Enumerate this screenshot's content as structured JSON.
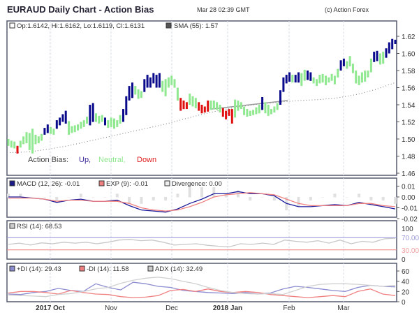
{
  "header": {
    "title": "EURAUD Daily Chart - Action Bias",
    "timestamp": "Mar 28 02:39 GMT",
    "copyright": "(c) Action Forex"
  },
  "colors": {
    "up": "#0a0a8c",
    "neutral": "#90e890",
    "down": "#e01010",
    "macd": "#1a1a9a",
    "exp": "#f08080",
    "divergence": "#e0e0e0",
    "rsi": "#c8c8c8",
    "plus_di": "#8c8cd0",
    "minus_di": "#f08080",
    "adx": "#d0d0d0"
  },
  "chart_data": [
    {
      "type": "ohlc-bars",
      "title": "EURAUD Daily Chart - Action Bias",
      "ohlc_label": "Op:1.6142, Hi:1.6162, Lo:1.6119, Cl:1.6131",
      "sma_label": "SMA (55): 1.57",
      "bias_legend": {
        "label": "Action Bias:",
        "up": "Up,",
        "neutral": "Neutral,",
        "down": "Down"
      },
      "ylim": [
        1.46,
        1.63
      ],
      "yticks": [
        "1.62",
        "1.60",
        "1.58",
        "1.56",
        "1.54",
        "1.52",
        "1.50",
        "1.48",
        "1.46"
      ],
      "xticks": [
        "2017 Oct",
        "Nov",
        "Dec",
        "2018 Jan",
        "Feb",
        "Mar"
      ],
      "bars": [
        [
          1.5,
          1.492,
          "n"
        ],
        [
          1.498,
          1.49,
          "n"
        ],
        [
          1.497,
          1.489,
          "n"
        ],
        [
          1.492,
          1.483,
          "d"
        ],
        [
          1.498,
          1.49,
          "n"
        ],
        [
          1.503,
          1.494,
          "n"
        ],
        [
          1.508,
          1.495,
          "n"
        ],
        [
          1.507,
          1.487,
          "n"
        ],
        [
          1.512,
          1.483,
          "n"
        ],
        [
          1.505,
          1.494,
          "n"
        ],
        [
          1.503,
          1.495,
          "n"
        ],
        [
          1.506,
          1.498,
          "n"
        ],
        [
          1.513,
          1.505,
          "u"
        ],
        [
          1.517,
          1.507,
          "u"
        ],
        [
          1.514,
          1.506,
          "n"
        ],
        [
          1.512,
          1.505,
          "n"
        ],
        [
          1.522,
          1.512,
          "u"
        ],
        [
          1.525,
          1.516,
          "u"
        ],
        [
          1.529,
          1.52,
          "u"
        ],
        [
          1.533,
          1.518,
          "u"
        ],
        [
          1.521,
          1.505,
          "n"
        ],
        [
          1.515,
          1.507,
          "n"
        ],
        [
          1.516,
          1.508,
          "n"
        ],
        [
          1.517,
          1.51,
          "n"
        ],
        [
          1.52,
          1.512,
          "n"
        ],
        [
          1.522,
          1.514,
          "n"
        ],
        [
          1.526,
          1.518,
          "n"
        ],
        [
          1.54,
          1.516,
          "u"
        ],
        [
          1.542,
          1.52,
          "u"
        ],
        [
          1.53,
          1.52,
          "n"
        ],
        [
          1.527,
          1.518,
          "n"
        ],
        [
          1.528,
          1.52,
          "n"
        ],
        [
          1.525,
          1.516,
          "u"
        ],
        [
          1.522,
          1.513,
          "n"
        ],
        [
          1.525,
          1.514,
          "n"
        ],
        [
          1.524,
          1.512,
          "n"
        ],
        [
          1.522,
          1.514,
          "n"
        ],
        [
          1.528,
          1.518,
          "n"
        ],
        [
          1.535,
          1.52,
          "u"
        ],
        [
          1.55,
          1.528,
          "u"
        ],
        [
          1.562,
          1.545,
          "u"
        ],
        [
          1.566,
          1.548,
          "u"
        ],
        [
          1.562,
          1.552,
          "n"
        ],
        [
          1.558,
          1.547,
          "n"
        ],
        [
          1.556,
          1.548,
          "n"
        ],
        [
          1.57,
          1.555,
          "u"
        ],
        [
          1.575,
          1.56,
          "u"
        ],
        [
          1.572,
          1.56,
          "u"
        ],
        [
          1.577,
          1.565,
          "u"
        ],
        [
          1.575,
          1.56,
          "u"
        ],
        [
          1.577,
          1.56,
          "u"
        ],
        [
          1.568,
          1.555,
          "n"
        ],
        [
          1.57,
          1.55,
          "n"
        ],
        [
          1.572,
          1.56,
          "n"
        ],
        [
          1.574,
          1.563,
          "n"
        ],
        [
          1.57,
          1.56,
          "n"
        ],
        [
          1.56,
          1.545,
          "n"
        ],
        [
          1.548,
          1.533,
          "d"
        ],
        [
          1.545,
          1.535,
          "d"
        ],
        [
          1.543,
          1.535,
          "d"
        ],
        [
          1.553,
          1.54,
          "n"
        ],
        [
          1.55,
          1.538,
          "n"
        ],
        [
          1.548,
          1.536,
          "n"
        ],
        [
          1.543,
          1.533,
          "d"
        ],
        [
          1.54,
          1.53,
          "d"
        ],
        [
          1.538,
          1.531,
          "d"
        ],
        [
          1.545,
          1.532,
          "d"
        ],
        [
          1.545,
          1.534,
          "n"
        ],
        [
          1.545,
          1.535,
          "n"
        ],
        [
          1.543,
          1.534,
          "n"
        ],
        [
          1.54,
          1.531,
          "n"
        ],
        [
          1.536,
          1.526,
          "d"
        ],
        [
          1.533,
          1.523,
          "d"
        ],
        [
          1.535,
          1.527,
          "d"
        ],
        [
          1.535,
          1.518,
          "d"
        ],
        [
          1.546,
          1.525,
          "n"
        ],
        [
          1.545,
          1.533,
          "n"
        ],
        [
          1.543,
          1.535,
          "n"
        ],
        [
          1.538,
          1.528,
          "n"
        ],
        [
          1.535,
          1.526,
          "n"
        ],
        [
          1.533,
          1.527,
          "n"
        ],
        [
          1.534,
          1.528,
          "n"
        ],
        [
          1.537,
          1.529,
          "n"
        ],
        [
          1.54,
          1.53,
          "n"
        ],
        [
          1.549,
          1.534,
          "u"
        ],
        [
          1.543,
          1.53,
          "n"
        ],
        [
          1.54,
          1.527,
          "n"
        ],
        [
          1.535,
          1.529,
          "n"
        ],
        [
          1.538,
          1.531,
          "n"
        ],
        [
          1.542,
          1.534,
          "n"
        ],
        [
          1.557,
          1.54,
          "u"
        ],
        [
          1.572,
          1.555,
          "u"
        ],
        [
          1.575,
          1.565,
          "u"
        ],
        [
          1.578,
          1.567,
          "u"
        ],
        [
          1.575,
          1.566,
          "n"
        ],
        [
          1.575,
          1.566,
          "u"
        ],
        [
          1.578,
          1.566,
          "u"
        ],
        [
          1.577,
          1.562,
          "n"
        ],
        [
          1.581,
          1.568,
          "n"
        ],
        [
          1.58,
          1.569,
          "u"
        ],
        [
          1.578,
          1.568,
          "u"
        ],
        [
          1.572,
          1.565,
          "n"
        ],
        [
          1.57,
          1.562,
          "n"
        ],
        [
          1.575,
          1.565,
          "n"
        ],
        [
          1.576,
          1.566,
          "n"
        ],
        [
          1.574,
          1.563,
          "n"
        ],
        [
          1.572,
          1.566,
          "n"
        ],
        [
          1.576,
          1.568,
          "n"
        ],
        [
          1.574,
          1.564,
          "n"
        ],
        [
          1.582,
          1.572,
          "n"
        ],
        [
          1.592,
          1.58,
          "u"
        ],
        [
          1.594,
          1.585,
          "u"
        ],
        [
          1.591,
          1.582,
          "n"
        ],
        [
          1.597,
          1.585,
          "n"
        ],
        [
          1.588,
          1.577,
          "n"
        ],
        [
          1.58,
          1.565,
          "n"
        ],
        [
          1.574,
          1.563,
          "n"
        ],
        [
          1.578,
          1.566,
          "n"
        ],
        [
          1.58,
          1.567,
          "n"
        ],
        [
          1.58,
          1.572,
          "n"
        ],
        [
          1.594,
          1.578,
          "n"
        ],
        [
          1.602,
          1.59,
          "u"
        ],
        [
          1.603,
          1.591,
          "u"
        ],
        [
          1.6,
          1.587,
          "n"
        ],
        [
          1.602,
          1.588,
          "n"
        ],
        [
          1.606,
          1.595,
          "u"
        ],
        [
          1.613,
          1.6,
          "u"
        ],
        [
          1.617,
          1.605,
          "u"
        ],
        [
          1.616,
          1.611,
          "u"
        ]
      ],
      "sma": [
        1.484,
        1.485,
        1.488,
        1.492,
        1.497,
        1.502,
        1.507,
        1.512,
        1.517,
        1.523,
        1.529,
        1.534,
        1.538,
        1.541,
        1.543,
        1.545,
        1.546,
        1.548,
        1.552,
        1.558,
        1.566
      ],
      "trendline": [
        1.535,
        1.545
      ]
    },
    {
      "type": "line",
      "name": "MACD",
      "legend": [
        "MACD (12, 26): -0.01",
        "EXP (9): -0.01",
        "Divergence: 0.00"
      ],
      "yticks": [
        "0.01",
        "0.00",
        "-0.01",
        "-0.02"
      ],
      "ylim": [
        -0.02,
        0.013
      ],
      "series": [
        {
          "name": "MACD",
          "values": [
            0.0,
            0.0,
            -0.001,
            -0.002,
            -0.005,
            -0.003,
            -0.002,
            -0.004,
            -0.004,
            -0.003,
            -0.008,
            -0.012,
            -0.013,
            -0.014,
            -0.011,
            -0.006,
            -0.002,
            0.003,
            0.003,
            0.005,
            0.003,
            0.003,
            0.001,
            -0.006,
            -0.009,
            -0.009,
            -0.008,
            -0.007,
            -0.008,
            -0.005,
            -0.007,
            -0.009,
            -0.011
          ]
        },
        {
          "name": "EXP",
          "values": [
            -0.001,
            -0.001,
            -0.001,
            -0.002,
            -0.004,
            -0.003,
            -0.003,
            -0.004,
            -0.004,
            -0.004,
            -0.006,
            -0.01,
            -0.012,
            -0.013,
            -0.012,
            -0.009,
            -0.005,
            0.0,
            0.002,
            0.003,
            0.004,
            0.003,
            0.002,
            -0.002,
            -0.006,
            -0.008,
            -0.008,
            -0.008,
            -0.008,
            -0.006,
            -0.006,
            -0.008,
            -0.009
          ]
        }
      ]
    },
    {
      "type": "line",
      "name": "RSI",
      "legend": [
        "RSI (14): 68.53"
      ],
      "yticks": [
        "100",
        "70.00",
        "30.00",
        "0"
      ],
      "levels": [
        70,
        30
      ],
      "ylim": [
        0,
        100
      ],
      "series": [
        {
          "name": "RSI",
          "values": [
            48,
            52,
            46,
            53,
            50,
            55,
            52,
            55,
            50,
            55,
            62,
            64,
            60,
            62,
            55,
            46,
            48,
            50,
            45,
            42,
            40,
            50,
            48,
            52,
            48,
            62,
            58,
            55,
            60,
            52,
            62,
            50,
            58,
            55,
            66,
            68
          ]
        }
      ]
    },
    {
      "type": "line",
      "name": "DMI",
      "legend": [
        "+DI (14): 29.43",
        "-DI (14): 11.58",
        "ADX (14): 32.49"
      ],
      "yticks": [
        "60",
        "40",
        "20",
        "0"
      ],
      "ylim": [
        0,
        70
      ],
      "series": [
        {
          "name": "+DI",
          "values": [
            15,
            14,
            18,
            20,
            26,
            22,
            20,
            35,
            28,
            23,
            38,
            35,
            30,
            28,
            22,
            20,
            18,
            17,
            16,
            18,
            15,
            17,
            25,
            30,
            28,
            25,
            22,
            20,
            28,
            32,
            30,
            29
          ]
        },
        {
          "name": "-DI",
          "values": [
            17,
            20,
            20,
            18,
            15,
            22,
            18,
            15,
            14,
            10,
            8,
            9,
            12,
            22,
            24,
            20,
            25,
            20,
            18,
            20,
            18,
            14,
            12,
            10,
            8,
            10,
            12,
            10,
            20,
            25,
            15,
            12
          ]
        },
        {
          "name": "ADX",
          "values": [
            13,
            12,
            11,
            10,
            14,
            16,
            20,
            25,
            28,
            36,
            42,
            46,
            48,
            45,
            40,
            35,
            28,
            22,
            18,
            16,
            15,
            16,
            14,
            22,
            30,
            34,
            35,
            35,
            34,
            32,
            30,
            32
          ]
        }
      ]
    }
  ]
}
